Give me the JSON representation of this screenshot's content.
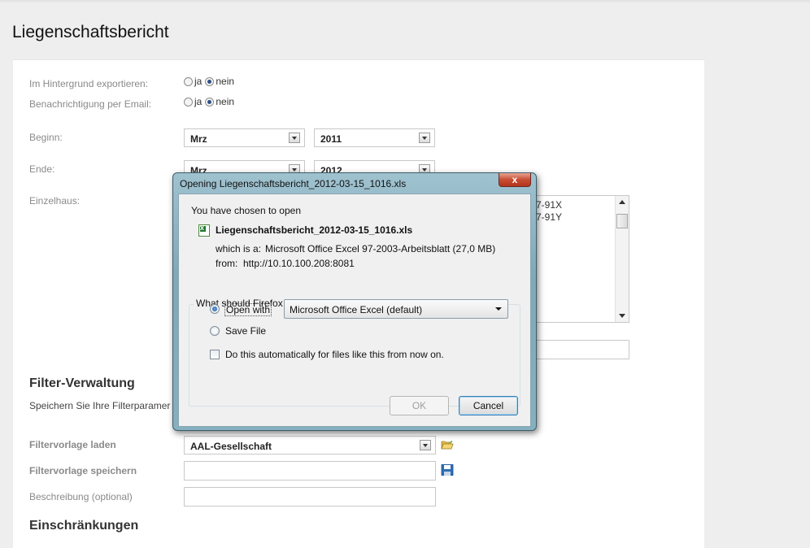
{
  "page": {
    "title": "Liegenschaftsbericht"
  },
  "form": {
    "background_export": {
      "label": "Im Hintergrund exportieren:",
      "yes": "ja",
      "no": "nein",
      "selected": "nein"
    },
    "email_notify": {
      "label": "Benachrichtigung per Email:",
      "yes": "ja",
      "no": "nein",
      "selected": "nein"
    },
    "begin": {
      "label": "Beginn:",
      "month": "Mrz",
      "year": "2011"
    },
    "end": {
      "label": "Ende:",
      "month": "Mrz",
      "year": "2012"
    },
    "house": {
      "label": "Einzelhaus:",
      "list_items": [
        "7-91X",
        "7-91Y"
      ]
    }
  },
  "filter": {
    "heading": "Filter-Verwaltung",
    "description": "Speichern Sie Ihre Filterparamer",
    "load_label": "Filtervorlage laden",
    "load_value": "AAL-Gesellschaft",
    "save_label": "Filtervorlage speichern",
    "desc_label": "Beschreibung (optional)"
  },
  "restrictions": {
    "heading": "Einschränkungen"
  },
  "dialog": {
    "title": "Opening Liegenschaftsbericht_2012-03-15_1016.xls",
    "close_label": "x",
    "intro": "You have chosen to open",
    "filename": "Liegenschaftsbericht_2012-03-15_1016.xls",
    "which_is_label": "which is a:",
    "which_is_value": "Microsoft Office Excel 97-2003-Arbeitsblatt (27,0 MB)",
    "from_label": "from:",
    "from_value": "http://10.10.100.208:8081",
    "question": "What should Firefox do with this file?",
    "open_with_label": "Open with",
    "open_with_app": "Microsoft Office Excel (default)",
    "save_file_label": "Save File",
    "auto_label": "Do this automatically for files like this from now on.",
    "ok_label": "OK",
    "cancel_label": "Cancel"
  }
}
